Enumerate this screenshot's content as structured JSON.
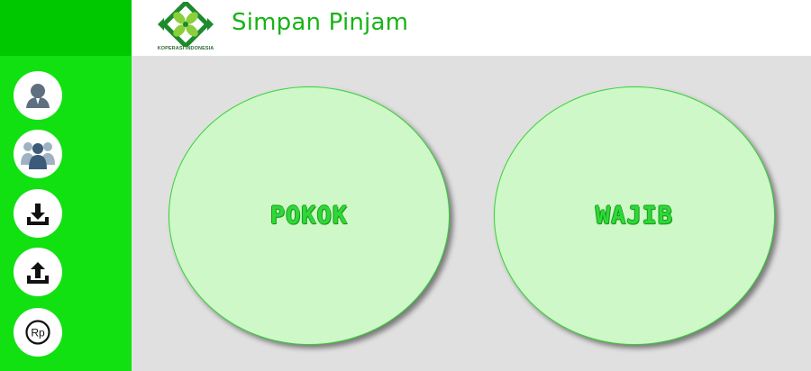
{
  "header": {
    "title": "Simpan Pinjam",
    "logo_caption": "KOPERASI INDONESIA"
  },
  "sidebar": {
    "items": [
      {
        "name": "user",
        "icon": "user-icon"
      },
      {
        "name": "members",
        "icon": "group-icon"
      },
      {
        "name": "deposit",
        "icon": "download-icon"
      },
      {
        "name": "withdraw",
        "icon": "upload-icon"
      },
      {
        "name": "rupiah",
        "icon": "rupiah-icon",
        "icon_text": "Rp"
      }
    ]
  },
  "main": {
    "options": [
      {
        "label": "POKOK"
      },
      {
        "label": "WAJIB"
      }
    ]
  },
  "colors": {
    "sidebar_top": "#00c800",
    "sidebar": "#11e111",
    "title": "#17b317",
    "circle_fill": "#cff8c8",
    "circle_label": "#2ed838",
    "background": "#e0e0e0"
  }
}
